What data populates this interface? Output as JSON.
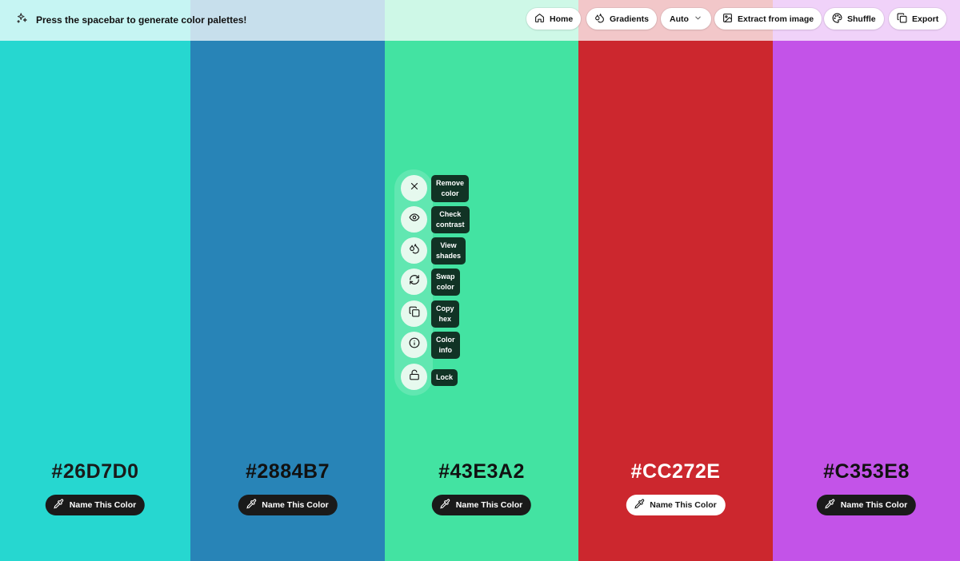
{
  "header": {
    "hint": "Press the spacebar to generate color palettes!",
    "buttons": {
      "home": "Home",
      "gradients": "Gradients",
      "mode": "Auto",
      "extract": "Extract from image",
      "shuffle": "Shuffle",
      "export": "Export"
    }
  },
  "palette": [
    {
      "hex": "#26D7D0",
      "color": "#26D7D0",
      "text_color": "#1a1a1a",
      "button_style": "dark",
      "name_label": "Name This Color"
    },
    {
      "hex": "#2884B7",
      "color": "#2884B7",
      "text_color": "#111111",
      "button_style": "dark",
      "name_label": "Name This Color"
    },
    {
      "hex": "#43E3A2",
      "color": "#43E3A2",
      "text_color": "#111111",
      "button_style": "dark",
      "name_label": "Name This Color"
    },
    {
      "hex": "#CC272E",
      "color": "#CC272E",
      "text_color": "#ffffff",
      "button_style": "light",
      "name_label": "Name This Color"
    },
    {
      "hex": "#C353E8",
      "color": "#C353E8",
      "text_color": "#111111",
      "button_style": "dark",
      "name_label": "Name This Color"
    }
  ],
  "tools": [
    {
      "icon": "close-icon",
      "label_line1": "Remove",
      "label_line2": "color"
    },
    {
      "icon": "eye-icon",
      "label_line1": "Check",
      "label_line2": "contrast"
    },
    {
      "icon": "drops-icon",
      "label_line1": "View",
      "label_line2": "shades"
    },
    {
      "icon": "swap-icon",
      "label_line1": "Swap",
      "label_line2": "color"
    },
    {
      "icon": "copy-icon",
      "label_line1": "Copy",
      "label_line2": "hex"
    },
    {
      "icon": "info-icon",
      "label_line1": "Color",
      "label_line2": "info"
    },
    {
      "icon": "unlock-icon",
      "label_line1": "Lock",
      "label_line2": ""
    }
  ]
}
